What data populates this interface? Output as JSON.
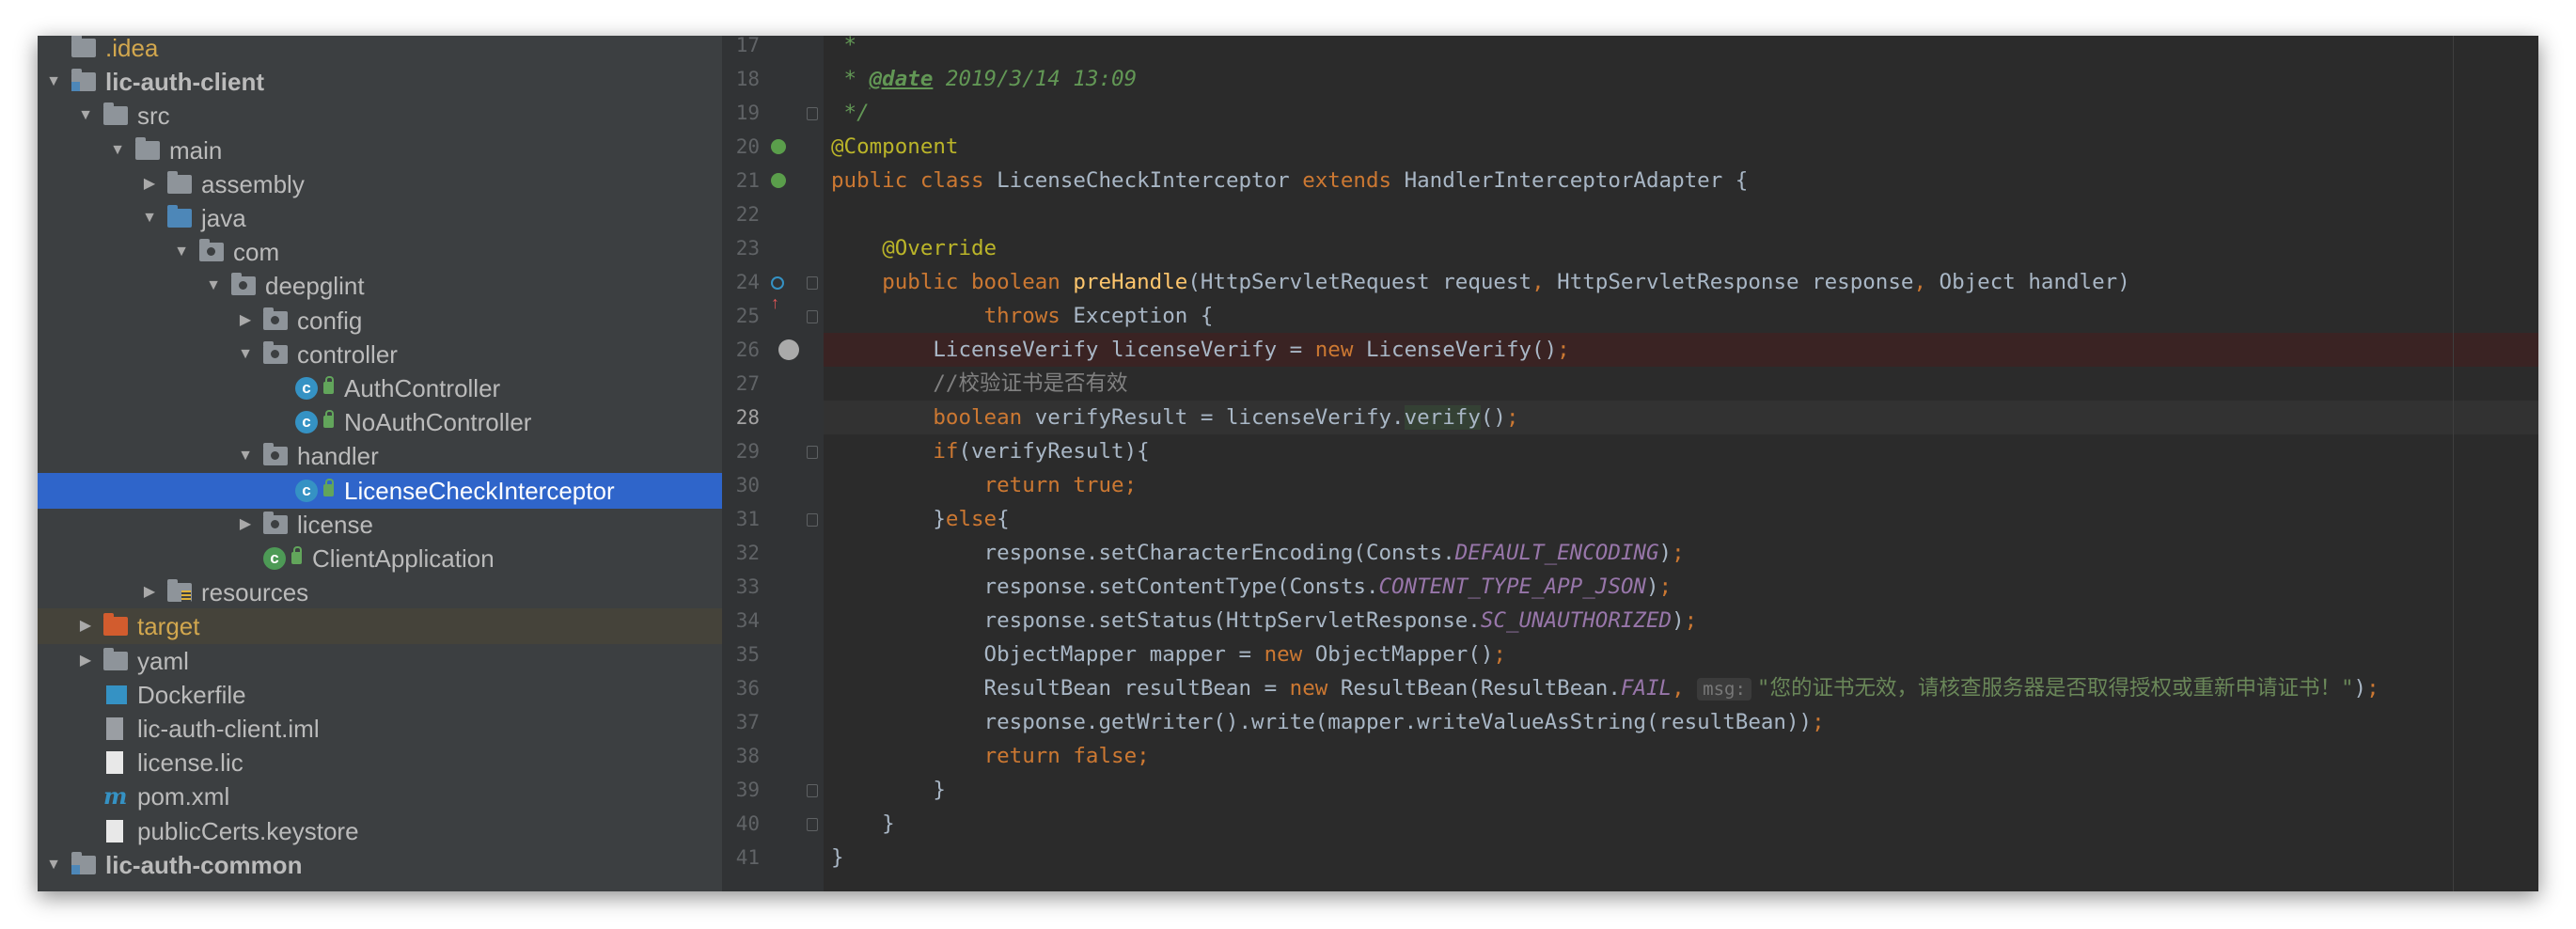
{
  "tree": {
    "rows": [
      {
        "label": ".idea",
        "depth": 0,
        "arrow": "",
        "icon": "folder",
        "style": "dim"
      },
      {
        "label": "lic-auth-client",
        "depth": 0,
        "arrow": "down",
        "icon": "module-folder",
        "style": "bold"
      },
      {
        "label": "src",
        "depth": 1,
        "arrow": "down",
        "icon": "folder",
        "style": ""
      },
      {
        "label": "main",
        "depth": 2,
        "arrow": "down",
        "icon": "folder",
        "style": ""
      },
      {
        "label": "assembly",
        "depth": 3,
        "arrow": "right",
        "icon": "folder",
        "style": ""
      },
      {
        "label": "java",
        "depth": 3,
        "arrow": "down",
        "icon": "source-folder",
        "style": ""
      },
      {
        "label": "com",
        "depth": 4,
        "arrow": "down",
        "icon": "package",
        "style": ""
      },
      {
        "label": "deepglint",
        "depth": 5,
        "arrow": "down",
        "icon": "package",
        "style": ""
      },
      {
        "label": "config",
        "depth": 6,
        "arrow": "right",
        "icon": "package",
        "style": ""
      },
      {
        "label": "controller",
        "depth": 6,
        "arrow": "down",
        "icon": "package",
        "style": ""
      },
      {
        "label": "AuthController",
        "depth": 7,
        "arrow": "",
        "icon": "class",
        "style": ""
      },
      {
        "label": "NoAuthController",
        "depth": 7,
        "arrow": "",
        "icon": "class",
        "style": ""
      },
      {
        "label": "handler",
        "depth": 6,
        "arrow": "down",
        "icon": "package",
        "style": ""
      },
      {
        "label": "LicenseCheckInterceptor",
        "depth": 7,
        "arrow": "",
        "icon": "class",
        "style": "selected"
      },
      {
        "label": "license",
        "depth": 6,
        "arrow": "right",
        "icon": "package",
        "style": ""
      },
      {
        "label": "ClientApplication",
        "depth": 6,
        "arrow": "",
        "icon": "spring-class",
        "style": ""
      },
      {
        "label": "resources",
        "depth": 3,
        "arrow": "right",
        "icon": "resources-folder",
        "style": ""
      },
      {
        "label": "target",
        "depth": 1,
        "arrow": "right",
        "icon": "excluded-folder",
        "style": "excluded"
      },
      {
        "label": "yaml",
        "depth": 1,
        "arrow": "right",
        "icon": "folder",
        "style": ""
      },
      {
        "label": "Dockerfile",
        "depth": 1,
        "arrow": "",
        "icon": "docker-file",
        "style": ""
      },
      {
        "label": "lic-auth-client.iml",
        "depth": 1,
        "arrow": "",
        "icon": "iml-file",
        "style": ""
      },
      {
        "label": "license.lic",
        "depth": 1,
        "arrow": "",
        "icon": "text-file",
        "style": ""
      },
      {
        "label": "pom.xml",
        "depth": 1,
        "arrow": "",
        "icon": "maven-file",
        "style": ""
      },
      {
        "label": "publicCerts.keystore",
        "depth": 1,
        "arrow": "",
        "icon": "text-file",
        "style": ""
      },
      {
        "label": "lic-auth-common",
        "depth": 0,
        "arrow": "down",
        "icon": "module-folder",
        "style": "bold"
      }
    ]
  },
  "editor": {
    "lines": [
      {
        "n": "17",
        "parts": [
          {
            "t": " *",
            "c": "doc"
          }
        ]
      },
      {
        "n": "18",
        "parts": [
          {
            "t": " * ",
            "c": "doc"
          },
          {
            "t": "@date",
            "c": "tag"
          },
          {
            "t": " 2019/3/14 13:09",
            "c": "doc"
          }
        ]
      },
      {
        "n": "19",
        "parts": [
          {
            "t": " */",
            "c": "doc"
          }
        ],
        "fold": true
      },
      {
        "n": "20",
        "parts": [
          {
            "t": "@Component",
            "c": "ann"
          }
        ],
        "icon": "spring-bean-icon"
      },
      {
        "n": "21",
        "parts": [
          {
            "t": "public class ",
            "c": "kw"
          },
          {
            "t": "LicenseCheckInterceptor ",
            "c": ""
          },
          {
            "t": "extends ",
            "c": "kw"
          },
          {
            "t": "HandlerInterceptorAdapter {",
            "c": ""
          }
        ],
        "icon": "class-inherit-icon"
      },
      {
        "n": "22",
        "parts": []
      },
      {
        "n": "23",
        "parts": [
          {
            "t": "    ",
            "c": ""
          },
          {
            "t": "@Override",
            "c": "ann"
          }
        ]
      },
      {
        "n": "24",
        "parts": [
          {
            "t": "    ",
            "c": ""
          },
          {
            "t": "public boolean ",
            "c": "kw"
          },
          {
            "t": "preHandle",
            "c": "fn"
          },
          {
            "t": "(HttpServletRequest request",
            "c": ""
          },
          {
            "t": ", ",
            "c": "kw"
          },
          {
            "t": "HttpServletResponse response",
            "c": ""
          },
          {
            "t": ", ",
            "c": "kw"
          },
          {
            "t": "Object handler)",
            "c": ""
          }
        ],
        "icon": "override-icon",
        "fold": true
      },
      {
        "n": "25",
        "parts": [
          {
            "t": "            ",
            "c": ""
          },
          {
            "t": "throws ",
            "c": "kw"
          },
          {
            "t": "Exception {",
            "c": ""
          }
        ],
        "fold": true
      },
      {
        "n": "26",
        "parts": [
          {
            "t": "        LicenseVerify licenseVerify = ",
            "c": ""
          },
          {
            "t": "new ",
            "c": "kw"
          },
          {
            "t": "LicenseVerify()",
            "c": ""
          },
          {
            "t": ";",
            "c": "kw"
          }
        ],
        "breakpoint": true
      },
      {
        "n": "27",
        "parts": [
          {
            "t": "        ",
            "c": ""
          },
          {
            "t": "//校验证书是否有效",
            "c": "line"
          }
        ]
      },
      {
        "n": "28",
        "parts": [
          {
            "t": "        ",
            "c": ""
          },
          {
            "t": "boolean ",
            "c": "kw"
          },
          {
            "t": "verifyResult = licenseVerify.",
            "c": ""
          },
          {
            "t": "verify",
            "c": "hl"
          },
          {
            "t": "()",
            "c": ""
          },
          {
            "t": ";",
            "c": "kw"
          }
        ],
        "current": true
      },
      {
        "n": "29",
        "parts": [
          {
            "t": "        ",
            "c": ""
          },
          {
            "t": "if",
            "c": "kw"
          },
          {
            "t": "(verifyResult){",
            "c": ""
          }
        ],
        "fold": true
      },
      {
        "n": "30",
        "parts": [
          {
            "t": "            ",
            "c": ""
          },
          {
            "t": "return true;",
            "c": "kw"
          }
        ]
      },
      {
        "n": "31",
        "parts": [
          {
            "t": "        }",
            "c": ""
          },
          {
            "t": "else",
            "c": "kw"
          },
          {
            "t": "{",
            "c": ""
          }
        ],
        "fold": true
      },
      {
        "n": "32",
        "parts": [
          {
            "t": "            response.setCharacterEncoding(Consts.",
            "c": ""
          },
          {
            "t": "DEFAULT_ENCODING",
            "c": "const"
          },
          {
            "t": ")",
            "c": ""
          },
          {
            "t": ";",
            "c": "kw"
          }
        ]
      },
      {
        "n": "33",
        "parts": [
          {
            "t": "            response.setContentType(Consts.",
            "c": ""
          },
          {
            "t": "CONTENT_TYPE_APP_JSON",
            "c": "const"
          },
          {
            "t": ")",
            "c": ""
          },
          {
            "t": ";",
            "c": "kw"
          }
        ]
      },
      {
        "n": "34",
        "parts": [
          {
            "t": "            response.setStatus(HttpServletResponse.",
            "c": ""
          },
          {
            "t": "SC_UNAUTHORIZED",
            "c": "const"
          },
          {
            "t": ")",
            "c": ""
          },
          {
            "t": ";",
            "c": "kw"
          }
        ]
      },
      {
        "n": "35",
        "parts": [
          {
            "t": "            ObjectMapper mapper = ",
            "c": ""
          },
          {
            "t": "new ",
            "c": "kw"
          },
          {
            "t": "ObjectMapper()",
            "c": ""
          },
          {
            "t": ";",
            "c": "kw"
          }
        ]
      },
      {
        "n": "36",
        "parts": [
          {
            "t": "            ResultBean resultBean = ",
            "c": ""
          },
          {
            "t": "new ",
            "c": "kw"
          },
          {
            "t": "ResultBean(ResultBean.",
            "c": ""
          },
          {
            "t": "FAIL",
            "c": "const"
          },
          {
            "t": ", ",
            "c": "kw"
          },
          {
            "t": "msg:",
            "c": "hint"
          },
          {
            "t": "\"您的证书无效，请核查服务器是否取得授权或重新申请证书！\"",
            "c": "str"
          },
          {
            "t": ")",
            "c": ""
          },
          {
            "t": ";",
            "c": "kw"
          }
        ]
      },
      {
        "n": "37",
        "parts": [
          {
            "t": "            response.getWriter().write(mapper.writeValueAsString(resultBean))",
            "c": ""
          },
          {
            "t": ";",
            "c": "kw"
          }
        ]
      },
      {
        "n": "38",
        "parts": [
          {
            "t": "            ",
            "c": ""
          },
          {
            "t": "return false;",
            "c": "kw"
          }
        ]
      },
      {
        "n": "39",
        "parts": [
          {
            "t": "        }",
            "c": ""
          }
        ],
        "fold": true
      },
      {
        "n": "40",
        "parts": [
          {
            "t": "    }",
            "c": ""
          }
        ],
        "fold": true
      },
      {
        "n": "41",
        "parts": [
          {
            "t": "}",
            "c": ""
          }
        ]
      }
    ]
  },
  "colors": {
    "tree_bg": "#3c3f41",
    "editor_bg": "#2b2b2b",
    "selection": "#2f65ca",
    "keyword": "#cc7832",
    "annotation": "#bbb529",
    "string": "#6a8759",
    "constant": "#9876aa",
    "method": "#ffc66d"
  }
}
